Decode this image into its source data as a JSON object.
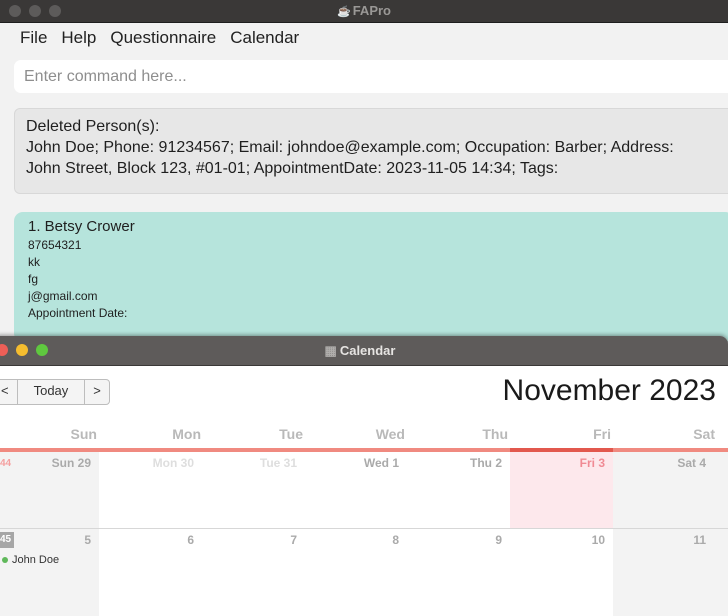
{
  "main_window": {
    "title": "FAPro",
    "menu": [
      "File",
      "Help",
      "Questionnaire",
      "Calendar"
    ],
    "command_placeholder": "Enter command here...",
    "result_lines": [
      "Deleted Person(s):",
      "John Doe; Phone: 91234567; Email: johndoe@example.com; Occupation: Barber; Address:",
      "John Street, Block 123, #01-01; AppointmentDate: 2023-11-05 14:34; Tags:"
    ],
    "person_card": {
      "name": "1.  Betsy Crower",
      "phone": "87654321",
      "occupation": "kk",
      "address": "fg",
      "email": "j@gmail.com",
      "appointment": "Appointment Date:"
    }
  },
  "calendar_window": {
    "title": "Calendar",
    "nav": {
      "prev": "<",
      "today": "Today",
      "next": ">"
    },
    "month_label": "November 2023",
    "days_of_week": [
      "Sun",
      "Mon",
      "Tue",
      "Wed",
      "Thu",
      "Fri",
      "Sat"
    ],
    "week_numbers": [
      "44",
      "45"
    ],
    "week1": [
      "Sun 29",
      "Mon 30",
      "Tue 31",
      "Wed 1",
      "Thu 2",
      "Fri 3",
      "Sat 4"
    ],
    "week2": [
      "5",
      "6",
      "7",
      "8",
      "9",
      "10",
      "11"
    ],
    "event": "John Doe",
    "colors": {
      "accent": "#f08a80",
      "today_accent": "#e2584e",
      "today_bg": "#fde8ec",
      "event_dot": "#5fb85a",
      "card_bg": "#b6e4dc"
    }
  }
}
